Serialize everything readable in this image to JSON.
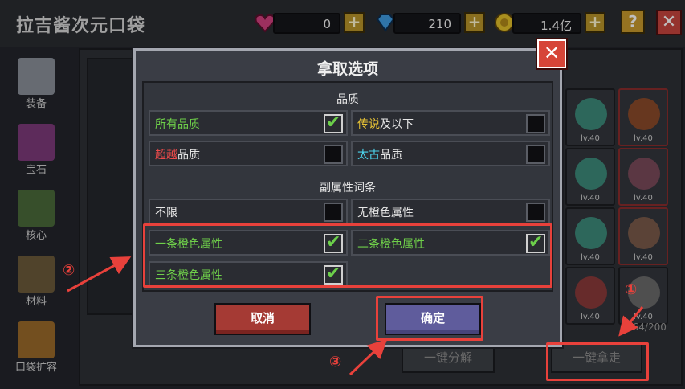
{
  "header": {
    "title": "拉吉酱次元口袋",
    "currencies": [
      {
        "icon": "heart-gem-icon",
        "value": "0",
        "color": "#d2407f"
      },
      {
        "icon": "diamond-icon",
        "value": "210",
        "color": "#3f9be0"
      },
      {
        "icon": "coin-icon",
        "value": "1.4亿",
        "color": "#e2bf2a"
      }
    ],
    "plus": "+",
    "help": "?",
    "close": "✕"
  },
  "nav": {
    "items": [
      {
        "label": "装备",
        "icon": "armor-icon"
      },
      {
        "label": "宝石",
        "icon": "gem-icon"
      },
      {
        "label": "核心",
        "icon": "core-icon"
      },
      {
        "label": "材料",
        "icon": "material-icon"
      },
      {
        "label": "口袋扩容",
        "icon": "chest-icon"
      }
    ]
  },
  "inventory": {
    "slot_levels": [
      "lv.40",
      "lv.40",
      "lv.40",
      "lv.40",
      "lv.40",
      "lv.40",
      "lv.40",
      "lv.40"
    ],
    "count": "164/200",
    "decompose_label": "一键分解",
    "take_all_label": "一键拿走"
  },
  "modal": {
    "title": "拿取选项",
    "close": "✕",
    "quality_label": "品质",
    "quality_options": [
      {
        "parts": [
          {
            "t": "所有品质",
            "c": "green"
          }
        ],
        "checked": true
      },
      {
        "parts": [
          {
            "t": "传说",
            "c": "yellow"
          },
          {
            "t": "及以下",
            "c": "white"
          }
        ],
        "checked": false
      },
      {
        "parts": [
          {
            "t": "超越",
            "c": "red"
          },
          {
            "t": "品质",
            "c": "white"
          }
        ],
        "checked": false
      },
      {
        "parts": [
          {
            "t": "太古",
            "c": "cyan"
          },
          {
            "t": "品质",
            "c": "white"
          }
        ],
        "checked": false
      }
    ],
    "sub_label": "副属性词条",
    "sub_options": [
      {
        "parts": [
          {
            "t": "不限",
            "c": "white"
          }
        ],
        "checked": false
      },
      {
        "parts": [
          {
            "t": "无橙色属性",
            "c": "white"
          }
        ],
        "checked": false
      },
      {
        "parts": [
          {
            "t": "一条橙色属性",
            "c": "green"
          }
        ],
        "checked": true
      },
      {
        "parts": [
          {
            "t": "二条橙色属性",
            "c": "green"
          }
        ],
        "checked": true
      },
      {
        "parts": [
          {
            "t": "三条橙色属性",
            "c": "green"
          }
        ],
        "checked": true
      }
    ],
    "cancel_label": "取消",
    "confirm_label": "确定"
  },
  "annotations": [
    "①",
    "②",
    "③"
  ]
}
